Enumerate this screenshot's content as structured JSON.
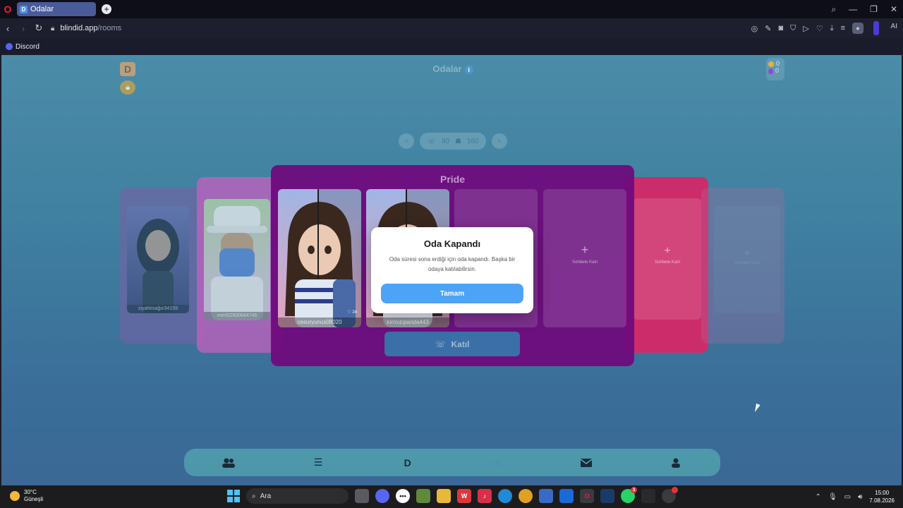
{
  "browser": {
    "tab_title": "Odalar",
    "tab_favicon": "D",
    "url_host": "blindid.app",
    "url_path": "/rooms",
    "bookmark": "Discord",
    "ai_label": "AI"
  },
  "app": {
    "page_title": "Odalar",
    "info_glyph": "i",
    "coins": "0",
    "gems": "0",
    "pager": {
      "calls": "80",
      "users": "160"
    },
    "rooms": {
      "main": {
        "title": "Pride",
        "members": [
          {
            "name": "cesuryunus08020",
            "likes": "24"
          },
          {
            "name": "kırmızıpanda443"
          }
        ],
        "empty_slot_label": "Sohbete Katıl",
        "join_label": "Katıl"
      },
      "left": {
        "member": "mert02600644745"
      },
      "far_left": {
        "member": "siyahlısağız34159"
      },
      "right": {
        "empty_slot_label": "Sohbete Katıl"
      },
      "far_right": {
        "empty_slot_label": "Sohbete Katıl"
      }
    },
    "modal": {
      "title": "Oda Kapandı",
      "message": "Oda süresi sona erdiği için oda kapandı. Başka bir odaya katılabilirsin.",
      "button": "Tamam"
    },
    "colors": {
      "main_card": "#6f0b7e",
      "modal_button": "#4da3f5",
      "right_card": "#cc2d6a"
    }
  },
  "taskbar": {
    "temp": "30°C",
    "condition": "Güneşli",
    "search_placeholder": "Ara",
    "whatsapp_badge": "3",
    "time": "15:00",
    "date": "7.08.2026"
  }
}
